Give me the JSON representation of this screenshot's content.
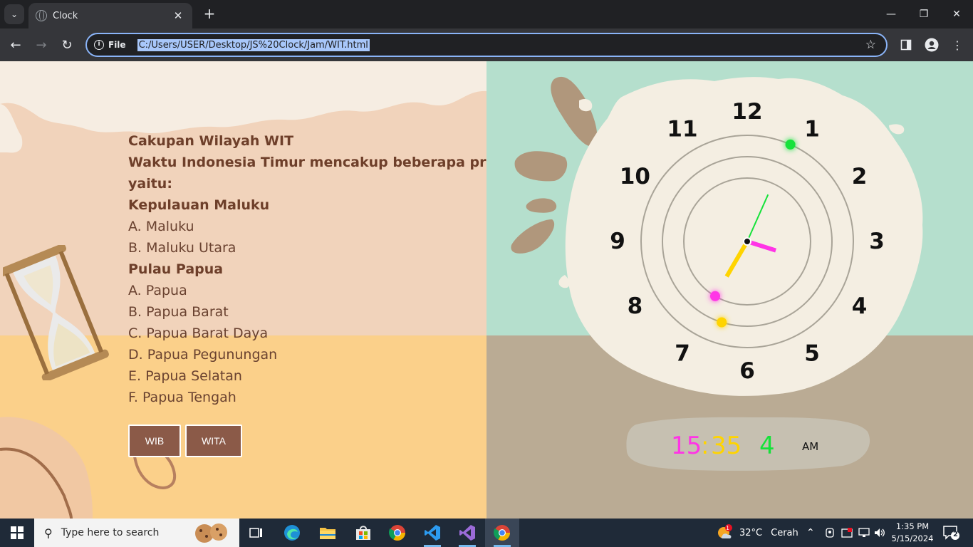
{
  "browser": {
    "tab_title": "Clock",
    "address_scheme": "File",
    "address_url": "C:/Users/USER/Desktop/JS%20Clock/Jam/WIT.html"
  },
  "page": {
    "lines": [
      {
        "text": "Cakupan Wilayah WIT",
        "bold": true
      },
      {
        "text": "Waktu Indonesia Timur mencakup beberapa provinsi,",
        "bold": true
      },
      {
        "text": "yaitu:",
        "bold": true
      },
      {
        "text": "Kepulauan Maluku",
        "bold": true
      },
      {
        "text": "A. Maluku",
        "bold": false
      },
      {
        "text": "B. Maluku Utara",
        "bold": false
      },
      {
        "text": "Pulau Papua",
        "bold": true
      },
      {
        "text": "A. Papua",
        "bold": false
      },
      {
        "text": "B. Papua Barat",
        "bold": false
      },
      {
        "text": "C. Papua Barat Daya",
        "bold": false
      },
      {
        "text": "D. Papua Pegunungan",
        "bold": false
      },
      {
        "text": "E. Papua Selatan",
        "bold": false
      },
      {
        "text": "F. Papua Tengah",
        "bold": false
      }
    ],
    "buttons": {
      "wib": "WIB",
      "wita": "WITA"
    },
    "clock": {
      "numerals": [
        "12",
        "1",
        "2",
        "3",
        "4",
        "5",
        "6",
        "7",
        "8",
        "9",
        "10",
        "11"
      ],
      "hours": 15,
      "minutes": 35,
      "seconds": 4,
      "hour_color": "#ff34e6",
      "minute_color": "#ffd400",
      "second_color": "#15e23a"
    },
    "digital": {
      "hours": "15",
      "colon": ":",
      "minutes": "35",
      "seconds": "4",
      "ampm": "AM"
    }
  },
  "taskbar": {
    "search_placeholder": "Type here to search",
    "weather_temp": "32°C",
    "weather_text": "Cerah",
    "time": "1:35 PM",
    "date": "5/15/2024",
    "notification_count": "2",
    "weather_badge": "1"
  }
}
